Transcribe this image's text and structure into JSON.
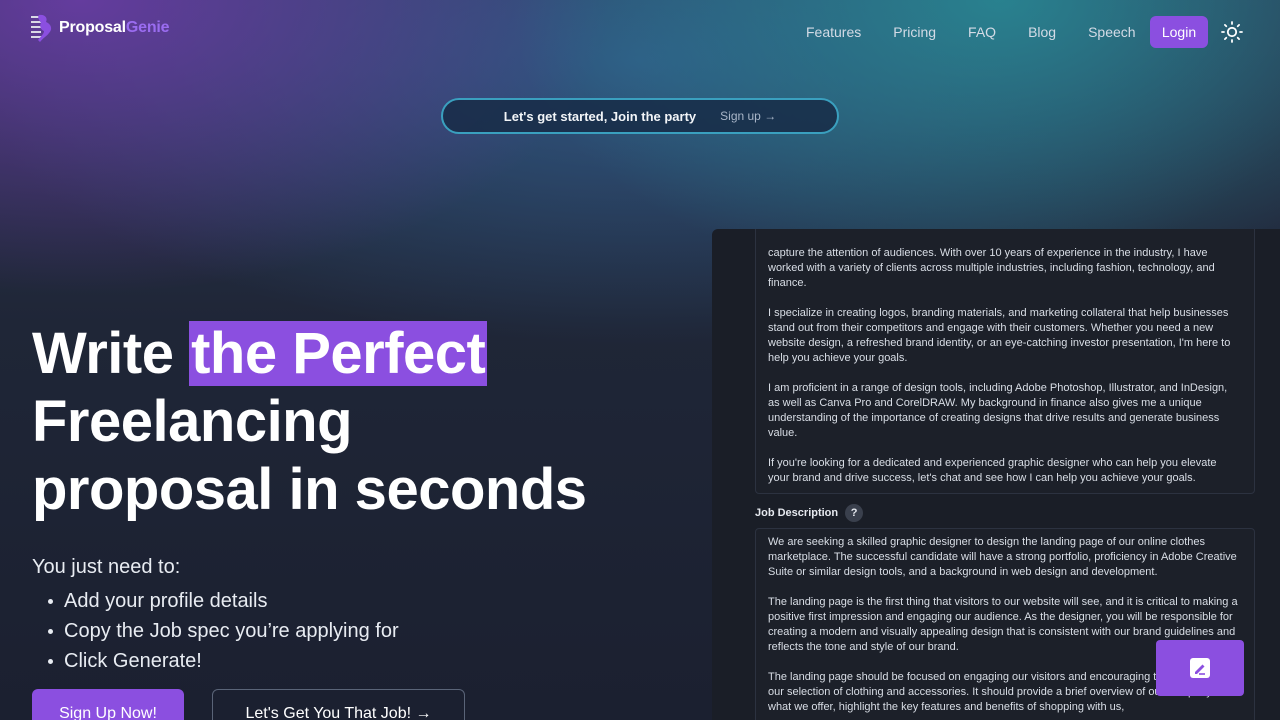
{
  "brand": {
    "name_part1": "Proposal",
    "name_part2": "Genie",
    "accent": "#8b4fe0"
  },
  "nav": {
    "links": [
      "Features",
      "Pricing",
      "FAQ",
      "Blog",
      "Speech"
    ],
    "login_label": "Login",
    "theme_icon": "sun-icon"
  },
  "announcement": {
    "text": "Let's get started, Join the party",
    "link_label": "Sign up →"
  },
  "hero": {
    "title_part1": "Write ",
    "title_highlight": "the Perfect",
    "title_line2": "Freelancing",
    "title_line3": "proposal in seconds",
    "subtitle": "You just need to:",
    "steps": [
      "Add your profile details",
      "Copy the Job spec you’re applying for",
      "Click Generate!"
    ],
    "primary_button": "Sign Up Now!",
    "secondary_button": "Let's Get You That Job! →"
  },
  "app": {
    "profile_paragraphs": [
      "capture the attention of audiences. With over 10 years of experience in the industry, I have worked with a variety of clients across multiple industries, including fashion, technology, and finance.",
      "I specialize in creating logos, branding materials, and marketing collateral that help businesses stand out from their competitors and engage with their customers. Whether you need a new website design, a refreshed brand identity, or an eye-catching investor presentation, I'm here to help you achieve your goals.",
      "I am proficient in a range of design tools, including Adobe Photoshop, Illustrator, and InDesign, as well as Canva Pro and CorelDRAW. My background in finance also gives me a unique understanding of the importance of creating designs that drive results and generate business value.",
      "If you're looking for a dedicated and experienced graphic designer who can help you elevate your brand and drive success, let's chat and see how I can help you achieve your goals."
    ],
    "job_description_label": "Job Description",
    "help_icon": "question-icon",
    "job_paragraphs": [
      "We are seeking a skilled graphic designer to design the landing page of our online clothes marketplace. The successful candidate will have a strong portfolio, proficiency in Adobe Creative Suite or similar design tools, and a background in web design and development.",
      "The landing page is the first thing that visitors to our website will see, and it is critical to making a positive first impression and engaging our audience. As the designer, you will be responsible for creating a modern and visually appealing design that is consistent with our brand guidelines and reflects the tone and style of our brand.",
      "The landing page should be focused on engaging our visitors and encouraging them to explore our selection of clothing and accessories. It should provide a brief overview of our company and what we offer, highlight the key features and benefits of shopping with us,"
    ],
    "fab_icon": "feedback-icon"
  }
}
